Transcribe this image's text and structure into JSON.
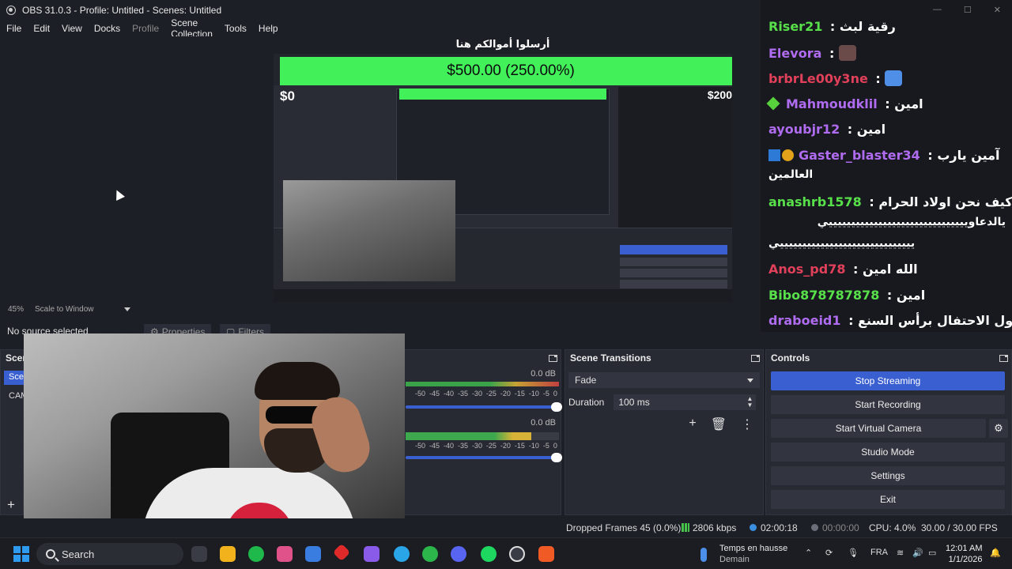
{
  "window": {
    "title": "OBS 31.0.3 - Profile: Untitled - Scenes: Untitled"
  },
  "menu": {
    "items": [
      "File",
      "Edit",
      "View",
      "Docks",
      "Profile",
      "Scene Collection",
      "Tools",
      "Help"
    ]
  },
  "stream_overlay": {
    "donation_heading": "أرسلوا أموالكم هنا",
    "goal_text": "$500.00 (250.00%)",
    "goal_min": "$0",
    "goal_max": "$200",
    "goal_progress": 2.5
  },
  "preview": {
    "zoom": "45%",
    "scale_mode": "Scale to Window"
  },
  "source_bar": {
    "status": "No source selected",
    "properties_label": "Properties",
    "filters_label": "Filters"
  },
  "scenes_dock": {
    "title": "Scenes",
    "items": [
      "Scene",
      "CAM"
    ]
  },
  "audio_dock": {
    "channels": [
      {
        "db": "0.0 dB",
        "fader_level": 1.0
      },
      {
        "db": "0.0 dB",
        "fader_level": 1.0
      }
    ],
    "scale_ticks": [
      "-50",
      "-45",
      "-40",
      "-35",
      "-30",
      "-25",
      "-20",
      "-15",
      "-10",
      "-5",
      "0"
    ]
  },
  "transitions_dock": {
    "title": "Scene Transitions",
    "selected": "Fade",
    "duration_label": "Duration",
    "duration_value": "100 ms"
  },
  "controls_dock": {
    "title": "Controls",
    "stop_streaming": "Stop Streaming",
    "start_recording": "Start Recording",
    "start_virtual_camera": "Start Virtual Camera",
    "studio_mode": "Studio Mode",
    "settings": "Settings",
    "exit": "Exit"
  },
  "chat": {
    "messages": [
      {
        "user": "Riser21",
        "color": "#58e04a",
        "text": "رقية لبث"
      },
      {
        "user": "Elevora",
        "color": "#b06cf0",
        "text": ""
      },
      {
        "user": "brbrLe00y3ne",
        "color": "#e0405a",
        "text": ""
      },
      {
        "user": "Mahmoudklil",
        "color": "#b06cf0",
        "text": "امين"
      },
      {
        "user": "ayoubjr12",
        "color": "#b06cf0",
        "text": "امين"
      },
      {
        "user": "Gaster_blaster34",
        "color": "#b06cf0",
        "text": "آمين يارب"
      },
      {
        "user": "anashrb1578",
        "color": "#58e04a",
        "text": "واتفاك كيف نحن اولاد الحرام"
      },
      {
        "user": "Anos_pd78",
        "color": "#e0405a",
        "text": "الله امين"
      },
      {
        "user": "Bibo878787878",
        "color": "#58e04a",
        "text": "امين"
      },
      {
        "user": "draboeid1",
        "color": "#b06cf0",
        "text": "لايجول الاحتفال برأس السنع"
      }
    ],
    "wrap_gaster": "العالمين",
    "wrap_anas_1": "يالدعاويييييييييييييييييييييييييييييييي",
    "wrap_anas_2": "ييييييييييييييييييييييييييييييي"
  },
  "status_bar": {
    "dropped_frames": "Dropped Frames 45 (0.0%)",
    "bitrate": "2806 kbps",
    "stream_time": "02:00:18",
    "record_time": "00:00:00",
    "cpu": "CPU: 4.0%",
    "fps": "30.00 / 30.00 FPS"
  },
  "taskbar": {
    "search_label": "Search",
    "weather_title": "Temps en hausse",
    "weather_sub": "Demain",
    "language": "FRA",
    "time": "12:01 AM",
    "date": "1/1/2026"
  },
  "colors": {
    "accent": "#3a5fd0",
    "goal_green": "#42f05a",
    "dock_bg": "#272a33"
  }
}
